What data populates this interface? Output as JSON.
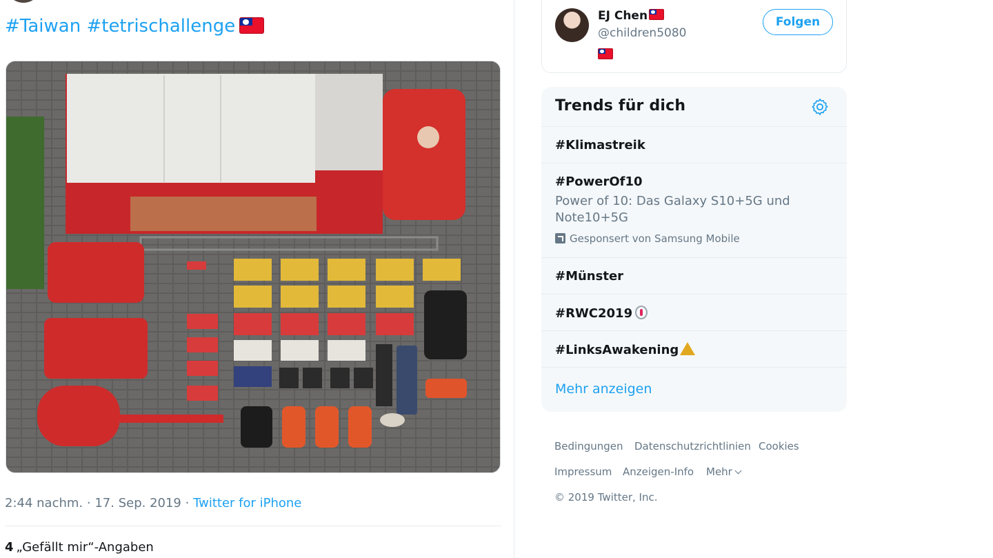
{
  "tweet": {
    "hashtags": "#Taiwan #tetrischallenge",
    "flag_icon": "taiwan-flag-emoji",
    "time": "2:44 nachm.",
    "separator": "·",
    "date": "17. Sep. 2019",
    "source": "Twitter for iPhone",
    "likes_count": "4",
    "likes_label": "„Gefällt mir“-Angaben"
  },
  "who_to_follow": {
    "name": "EJ Chen",
    "handle": "@children5080",
    "follow_button": "Folgen"
  },
  "trends": {
    "title": "Trends für dich",
    "items": [
      {
        "tag": "#Klimastreik"
      },
      {
        "tag": "#PowerOf10",
        "description": "Power of 10: Das Galaxy S10+5G und Note10+5G",
        "promoted": "Gesponsert von Samsung Mobile"
      },
      {
        "tag": "#Münster"
      },
      {
        "tag": "#RWC2019"
      },
      {
        "tag": "#LinksAwakening"
      }
    ],
    "show_more": "Mehr anzeigen"
  },
  "footer": {
    "links": [
      "Bedingungen",
      "Datenschutzrichtlinien",
      "Cookies",
      "Impressum",
      "Anzeigen-Info",
      "Mehr"
    ],
    "copyright": "© 2019 Twitter, Inc."
  },
  "colors": {
    "accent": "#1da1f2",
    "muted_text": "#657786",
    "trend_bg": "#f5f8fa"
  }
}
